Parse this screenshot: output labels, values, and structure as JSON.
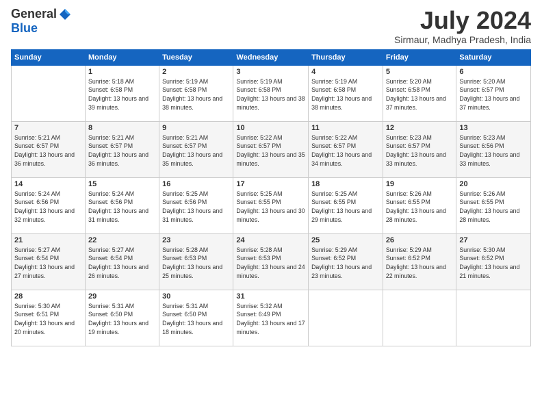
{
  "logo": {
    "general": "General",
    "blue": "Blue"
  },
  "title": "July 2024",
  "location": "Sirmaur, Madhya Pradesh, India",
  "columns": [
    "Sunday",
    "Monday",
    "Tuesday",
    "Wednesday",
    "Thursday",
    "Friday",
    "Saturday"
  ],
  "weeks": [
    [
      {
        "day": "",
        "sunrise": "",
        "sunset": "",
        "daylight": ""
      },
      {
        "day": "1",
        "sunrise": "Sunrise: 5:18 AM",
        "sunset": "Sunset: 6:58 PM",
        "daylight": "Daylight: 13 hours and 39 minutes."
      },
      {
        "day": "2",
        "sunrise": "Sunrise: 5:19 AM",
        "sunset": "Sunset: 6:58 PM",
        "daylight": "Daylight: 13 hours and 38 minutes."
      },
      {
        "day": "3",
        "sunrise": "Sunrise: 5:19 AM",
        "sunset": "Sunset: 6:58 PM",
        "daylight": "Daylight: 13 hours and 38 minutes."
      },
      {
        "day": "4",
        "sunrise": "Sunrise: 5:19 AM",
        "sunset": "Sunset: 6:58 PM",
        "daylight": "Daylight: 13 hours and 38 minutes."
      },
      {
        "day": "5",
        "sunrise": "Sunrise: 5:20 AM",
        "sunset": "Sunset: 6:58 PM",
        "daylight": "Daylight: 13 hours and 37 minutes."
      },
      {
        "day": "6",
        "sunrise": "Sunrise: 5:20 AM",
        "sunset": "Sunset: 6:57 PM",
        "daylight": "Daylight: 13 hours and 37 minutes."
      }
    ],
    [
      {
        "day": "7",
        "sunrise": "Sunrise: 5:21 AM",
        "sunset": "Sunset: 6:57 PM",
        "daylight": "Daylight: 13 hours and 36 minutes."
      },
      {
        "day": "8",
        "sunrise": "Sunrise: 5:21 AM",
        "sunset": "Sunset: 6:57 PM",
        "daylight": "Daylight: 13 hours and 36 minutes."
      },
      {
        "day": "9",
        "sunrise": "Sunrise: 5:21 AM",
        "sunset": "Sunset: 6:57 PM",
        "daylight": "Daylight: 13 hours and 35 minutes."
      },
      {
        "day": "10",
        "sunrise": "Sunrise: 5:22 AM",
        "sunset": "Sunset: 6:57 PM",
        "daylight": "Daylight: 13 hours and 35 minutes."
      },
      {
        "day": "11",
        "sunrise": "Sunrise: 5:22 AM",
        "sunset": "Sunset: 6:57 PM",
        "daylight": "Daylight: 13 hours and 34 minutes."
      },
      {
        "day": "12",
        "sunrise": "Sunrise: 5:23 AM",
        "sunset": "Sunset: 6:57 PM",
        "daylight": "Daylight: 13 hours and 33 minutes."
      },
      {
        "day": "13",
        "sunrise": "Sunrise: 5:23 AM",
        "sunset": "Sunset: 6:56 PM",
        "daylight": "Daylight: 13 hours and 33 minutes."
      }
    ],
    [
      {
        "day": "14",
        "sunrise": "Sunrise: 5:24 AM",
        "sunset": "Sunset: 6:56 PM",
        "daylight": "Daylight: 13 hours and 32 minutes."
      },
      {
        "day": "15",
        "sunrise": "Sunrise: 5:24 AM",
        "sunset": "Sunset: 6:56 PM",
        "daylight": "Daylight: 13 hours and 31 minutes."
      },
      {
        "day": "16",
        "sunrise": "Sunrise: 5:25 AM",
        "sunset": "Sunset: 6:56 PM",
        "daylight": "Daylight: 13 hours and 31 minutes."
      },
      {
        "day": "17",
        "sunrise": "Sunrise: 5:25 AM",
        "sunset": "Sunset: 6:55 PM",
        "daylight": "Daylight: 13 hours and 30 minutes."
      },
      {
        "day": "18",
        "sunrise": "Sunrise: 5:25 AM",
        "sunset": "Sunset: 6:55 PM",
        "daylight": "Daylight: 13 hours and 29 minutes."
      },
      {
        "day": "19",
        "sunrise": "Sunrise: 5:26 AM",
        "sunset": "Sunset: 6:55 PM",
        "daylight": "Daylight: 13 hours and 28 minutes."
      },
      {
        "day": "20",
        "sunrise": "Sunrise: 5:26 AM",
        "sunset": "Sunset: 6:55 PM",
        "daylight": "Daylight: 13 hours and 28 minutes."
      }
    ],
    [
      {
        "day": "21",
        "sunrise": "Sunrise: 5:27 AM",
        "sunset": "Sunset: 6:54 PM",
        "daylight": "Daylight: 13 hours and 27 minutes."
      },
      {
        "day": "22",
        "sunrise": "Sunrise: 5:27 AM",
        "sunset": "Sunset: 6:54 PM",
        "daylight": "Daylight: 13 hours and 26 minutes."
      },
      {
        "day": "23",
        "sunrise": "Sunrise: 5:28 AM",
        "sunset": "Sunset: 6:53 PM",
        "daylight": "Daylight: 13 hours and 25 minutes."
      },
      {
        "day": "24",
        "sunrise": "Sunrise: 5:28 AM",
        "sunset": "Sunset: 6:53 PM",
        "daylight": "Daylight: 13 hours and 24 minutes."
      },
      {
        "day": "25",
        "sunrise": "Sunrise: 5:29 AM",
        "sunset": "Sunset: 6:52 PM",
        "daylight": "Daylight: 13 hours and 23 minutes."
      },
      {
        "day": "26",
        "sunrise": "Sunrise: 5:29 AM",
        "sunset": "Sunset: 6:52 PM",
        "daylight": "Daylight: 13 hours and 22 minutes."
      },
      {
        "day": "27",
        "sunrise": "Sunrise: 5:30 AM",
        "sunset": "Sunset: 6:52 PM",
        "daylight": "Daylight: 13 hours and 21 minutes."
      }
    ],
    [
      {
        "day": "28",
        "sunrise": "Sunrise: 5:30 AM",
        "sunset": "Sunset: 6:51 PM",
        "daylight": "Daylight: 13 hours and 20 minutes."
      },
      {
        "day": "29",
        "sunrise": "Sunrise: 5:31 AM",
        "sunset": "Sunset: 6:50 PM",
        "daylight": "Daylight: 13 hours and 19 minutes."
      },
      {
        "day": "30",
        "sunrise": "Sunrise: 5:31 AM",
        "sunset": "Sunset: 6:50 PM",
        "daylight": "Daylight: 13 hours and 18 minutes."
      },
      {
        "day": "31",
        "sunrise": "Sunrise: 5:32 AM",
        "sunset": "Sunset: 6:49 PM",
        "daylight": "Daylight: 13 hours and 17 minutes."
      },
      {
        "day": "",
        "sunrise": "",
        "sunset": "",
        "daylight": ""
      },
      {
        "day": "",
        "sunrise": "",
        "sunset": "",
        "daylight": ""
      },
      {
        "day": "",
        "sunrise": "",
        "sunset": "",
        "daylight": ""
      }
    ]
  ]
}
